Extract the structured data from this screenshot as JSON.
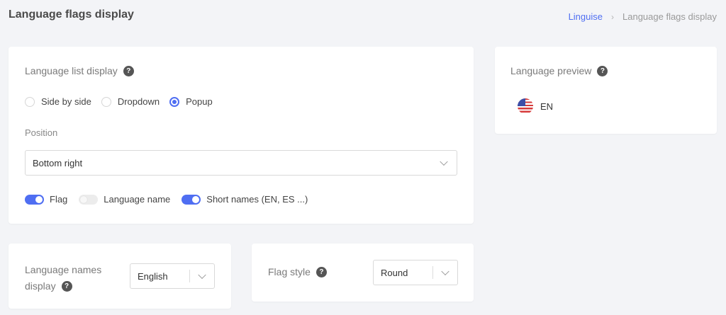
{
  "header": {
    "title": "Language flags display",
    "breadcrumb": {
      "link": "Linguise",
      "separator": "›",
      "current": "Language flags display"
    }
  },
  "main_card": {
    "list_display_label": "Language list display",
    "radios": [
      {
        "label": "Side by side",
        "checked": false
      },
      {
        "label": "Dropdown",
        "checked": false
      },
      {
        "label": "Popup",
        "checked": true
      }
    ],
    "position_label": "Position",
    "position_value": "Bottom right",
    "toggles": [
      {
        "label": "Flag",
        "on": true
      },
      {
        "label": "Language name",
        "on": false
      },
      {
        "label": "Short names (EN, ES ...)",
        "on": true
      }
    ]
  },
  "preview_card": {
    "label": "Language preview",
    "language_code": "EN",
    "flag_icon": "us-flag-icon"
  },
  "names_card": {
    "label_line1": "Language names",
    "label_line2": "display",
    "value": "English"
  },
  "flag_style_card": {
    "label": "Flag style",
    "value": "Round"
  },
  "help_icon_glyph": "?",
  "colors": {
    "accent": "#4f6ef2",
    "background": "#f3f4f7"
  }
}
